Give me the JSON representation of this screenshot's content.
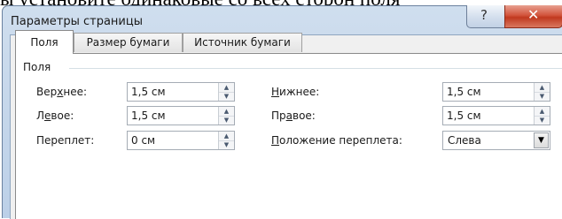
{
  "background_text": "ы установите одинаковые со всех сторон поля",
  "dialog": {
    "title": "Параметры страницы",
    "help_button": "?",
    "close_button": "✕",
    "tabs": [
      "Поля",
      "Размер бумаги",
      "Источник бумаги"
    ],
    "section": "Поля",
    "fields": {
      "top": {
        "pre": "Вер",
        "key": "х",
        "post": "нее:",
        "value": "1,5 см"
      },
      "left": {
        "pre": "Л",
        "key": "е",
        "post": "вое:",
        "value": "1,5 см"
      },
      "gutter": {
        "pre": "Переплет",
        "key": "",
        "post": ":",
        "value": "0 см"
      },
      "bottom": {
        "pre": "",
        "key": "Н",
        "post": "ижнее:",
        "value": "1,5 см"
      },
      "right": {
        "pre": "Пр",
        "key": "а",
        "post": "вое:",
        "value": "1,5 см"
      },
      "gutter_position": {
        "pre": "",
        "key": "П",
        "post": "оложение переплета:",
        "value": "Слева"
      }
    }
  },
  "colors": {
    "title_bar": "#c3d5ea",
    "close_button": "#c0391f",
    "panel": "#ffffff"
  }
}
